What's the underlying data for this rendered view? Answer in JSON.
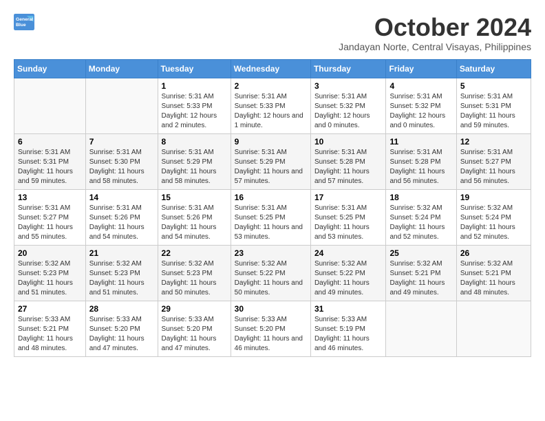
{
  "logo": {
    "line1": "General",
    "line2": "Blue"
  },
  "title": "October 2024",
  "subtitle": "Jandayan Norte, Central Visayas, Philippines",
  "header_days": [
    "Sunday",
    "Monday",
    "Tuesday",
    "Wednesday",
    "Thursday",
    "Friday",
    "Saturday"
  ],
  "weeks": [
    [
      {
        "day": "",
        "sunrise": "",
        "sunset": "",
        "daylight": ""
      },
      {
        "day": "",
        "sunrise": "",
        "sunset": "",
        "daylight": ""
      },
      {
        "day": "1",
        "sunrise": "Sunrise: 5:31 AM",
        "sunset": "Sunset: 5:33 PM",
        "daylight": "Daylight: 12 hours and 2 minutes."
      },
      {
        "day": "2",
        "sunrise": "Sunrise: 5:31 AM",
        "sunset": "Sunset: 5:33 PM",
        "daylight": "Daylight: 12 hours and 1 minute."
      },
      {
        "day": "3",
        "sunrise": "Sunrise: 5:31 AM",
        "sunset": "Sunset: 5:32 PM",
        "daylight": "Daylight: 12 hours and 0 minutes."
      },
      {
        "day": "4",
        "sunrise": "Sunrise: 5:31 AM",
        "sunset": "Sunset: 5:32 PM",
        "daylight": "Daylight: 12 hours and 0 minutes."
      },
      {
        "day": "5",
        "sunrise": "Sunrise: 5:31 AM",
        "sunset": "Sunset: 5:31 PM",
        "daylight": "Daylight: 11 hours and 59 minutes."
      }
    ],
    [
      {
        "day": "6",
        "sunrise": "Sunrise: 5:31 AM",
        "sunset": "Sunset: 5:31 PM",
        "daylight": "Daylight: 11 hours and 59 minutes."
      },
      {
        "day": "7",
        "sunrise": "Sunrise: 5:31 AM",
        "sunset": "Sunset: 5:30 PM",
        "daylight": "Daylight: 11 hours and 58 minutes."
      },
      {
        "day": "8",
        "sunrise": "Sunrise: 5:31 AM",
        "sunset": "Sunset: 5:29 PM",
        "daylight": "Daylight: 11 hours and 58 minutes."
      },
      {
        "day": "9",
        "sunrise": "Sunrise: 5:31 AM",
        "sunset": "Sunset: 5:29 PM",
        "daylight": "Daylight: 11 hours and 57 minutes."
      },
      {
        "day": "10",
        "sunrise": "Sunrise: 5:31 AM",
        "sunset": "Sunset: 5:28 PM",
        "daylight": "Daylight: 11 hours and 57 minutes."
      },
      {
        "day": "11",
        "sunrise": "Sunrise: 5:31 AM",
        "sunset": "Sunset: 5:28 PM",
        "daylight": "Daylight: 11 hours and 56 minutes."
      },
      {
        "day": "12",
        "sunrise": "Sunrise: 5:31 AM",
        "sunset": "Sunset: 5:27 PM",
        "daylight": "Daylight: 11 hours and 56 minutes."
      }
    ],
    [
      {
        "day": "13",
        "sunrise": "Sunrise: 5:31 AM",
        "sunset": "Sunset: 5:27 PM",
        "daylight": "Daylight: 11 hours and 55 minutes."
      },
      {
        "day": "14",
        "sunrise": "Sunrise: 5:31 AM",
        "sunset": "Sunset: 5:26 PM",
        "daylight": "Daylight: 11 hours and 54 minutes."
      },
      {
        "day": "15",
        "sunrise": "Sunrise: 5:31 AM",
        "sunset": "Sunset: 5:26 PM",
        "daylight": "Daylight: 11 hours and 54 minutes."
      },
      {
        "day": "16",
        "sunrise": "Sunrise: 5:31 AM",
        "sunset": "Sunset: 5:25 PM",
        "daylight": "Daylight: 11 hours and 53 minutes."
      },
      {
        "day": "17",
        "sunrise": "Sunrise: 5:31 AM",
        "sunset": "Sunset: 5:25 PM",
        "daylight": "Daylight: 11 hours and 53 minutes."
      },
      {
        "day": "18",
        "sunrise": "Sunrise: 5:32 AM",
        "sunset": "Sunset: 5:24 PM",
        "daylight": "Daylight: 11 hours and 52 minutes."
      },
      {
        "day": "19",
        "sunrise": "Sunrise: 5:32 AM",
        "sunset": "Sunset: 5:24 PM",
        "daylight": "Daylight: 11 hours and 52 minutes."
      }
    ],
    [
      {
        "day": "20",
        "sunrise": "Sunrise: 5:32 AM",
        "sunset": "Sunset: 5:23 PM",
        "daylight": "Daylight: 11 hours and 51 minutes."
      },
      {
        "day": "21",
        "sunrise": "Sunrise: 5:32 AM",
        "sunset": "Sunset: 5:23 PM",
        "daylight": "Daylight: 11 hours and 51 minutes."
      },
      {
        "day": "22",
        "sunrise": "Sunrise: 5:32 AM",
        "sunset": "Sunset: 5:23 PM",
        "daylight": "Daylight: 11 hours and 50 minutes."
      },
      {
        "day": "23",
        "sunrise": "Sunrise: 5:32 AM",
        "sunset": "Sunset: 5:22 PM",
        "daylight": "Daylight: 11 hours and 50 minutes."
      },
      {
        "day": "24",
        "sunrise": "Sunrise: 5:32 AM",
        "sunset": "Sunset: 5:22 PM",
        "daylight": "Daylight: 11 hours and 49 minutes."
      },
      {
        "day": "25",
        "sunrise": "Sunrise: 5:32 AM",
        "sunset": "Sunset: 5:21 PM",
        "daylight": "Daylight: 11 hours and 49 minutes."
      },
      {
        "day": "26",
        "sunrise": "Sunrise: 5:32 AM",
        "sunset": "Sunset: 5:21 PM",
        "daylight": "Daylight: 11 hours and 48 minutes."
      }
    ],
    [
      {
        "day": "27",
        "sunrise": "Sunrise: 5:33 AM",
        "sunset": "Sunset: 5:21 PM",
        "daylight": "Daylight: 11 hours and 48 minutes."
      },
      {
        "day": "28",
        "sunrise": "Sunrise: 5:33 AM",
        "sunset": "Sunset: 5:20 PM",
        "daylight": "Daylight: 11 hours and 47 minutes."
      },
      {
        "day": "29",
        "sunrise": "Sunrise: 5:33 AM",
        "sunset": "Sunset: 5:20 PM",
        "daylight": "Daylight: 11 hours and 47 minutes."
      },
      {
        "day": "30",
        "sunrise": "Sunrise: 5:33 AM",
        "sunset": "Sunset: 5:20 PM",
        "daylight": "Daylight: 11 hours and 46 minutes."
      },
      {
        "day": "31",
        "sunrise": "Sunrise: 5:33 AM",
        "sunset": "Sunset: 5:19 PM",
        "daylight": "Daylight: 11 hours and 46 minutes."
      },
      {
        "day": "",
        "sunrise": "",
        "sunset": "",
        "daylight": ""
      },
      {
        "day": "",
        "sunrise": "",
        "sunset": "",
        "daylight": ""
      }
    ]
  ]
}
